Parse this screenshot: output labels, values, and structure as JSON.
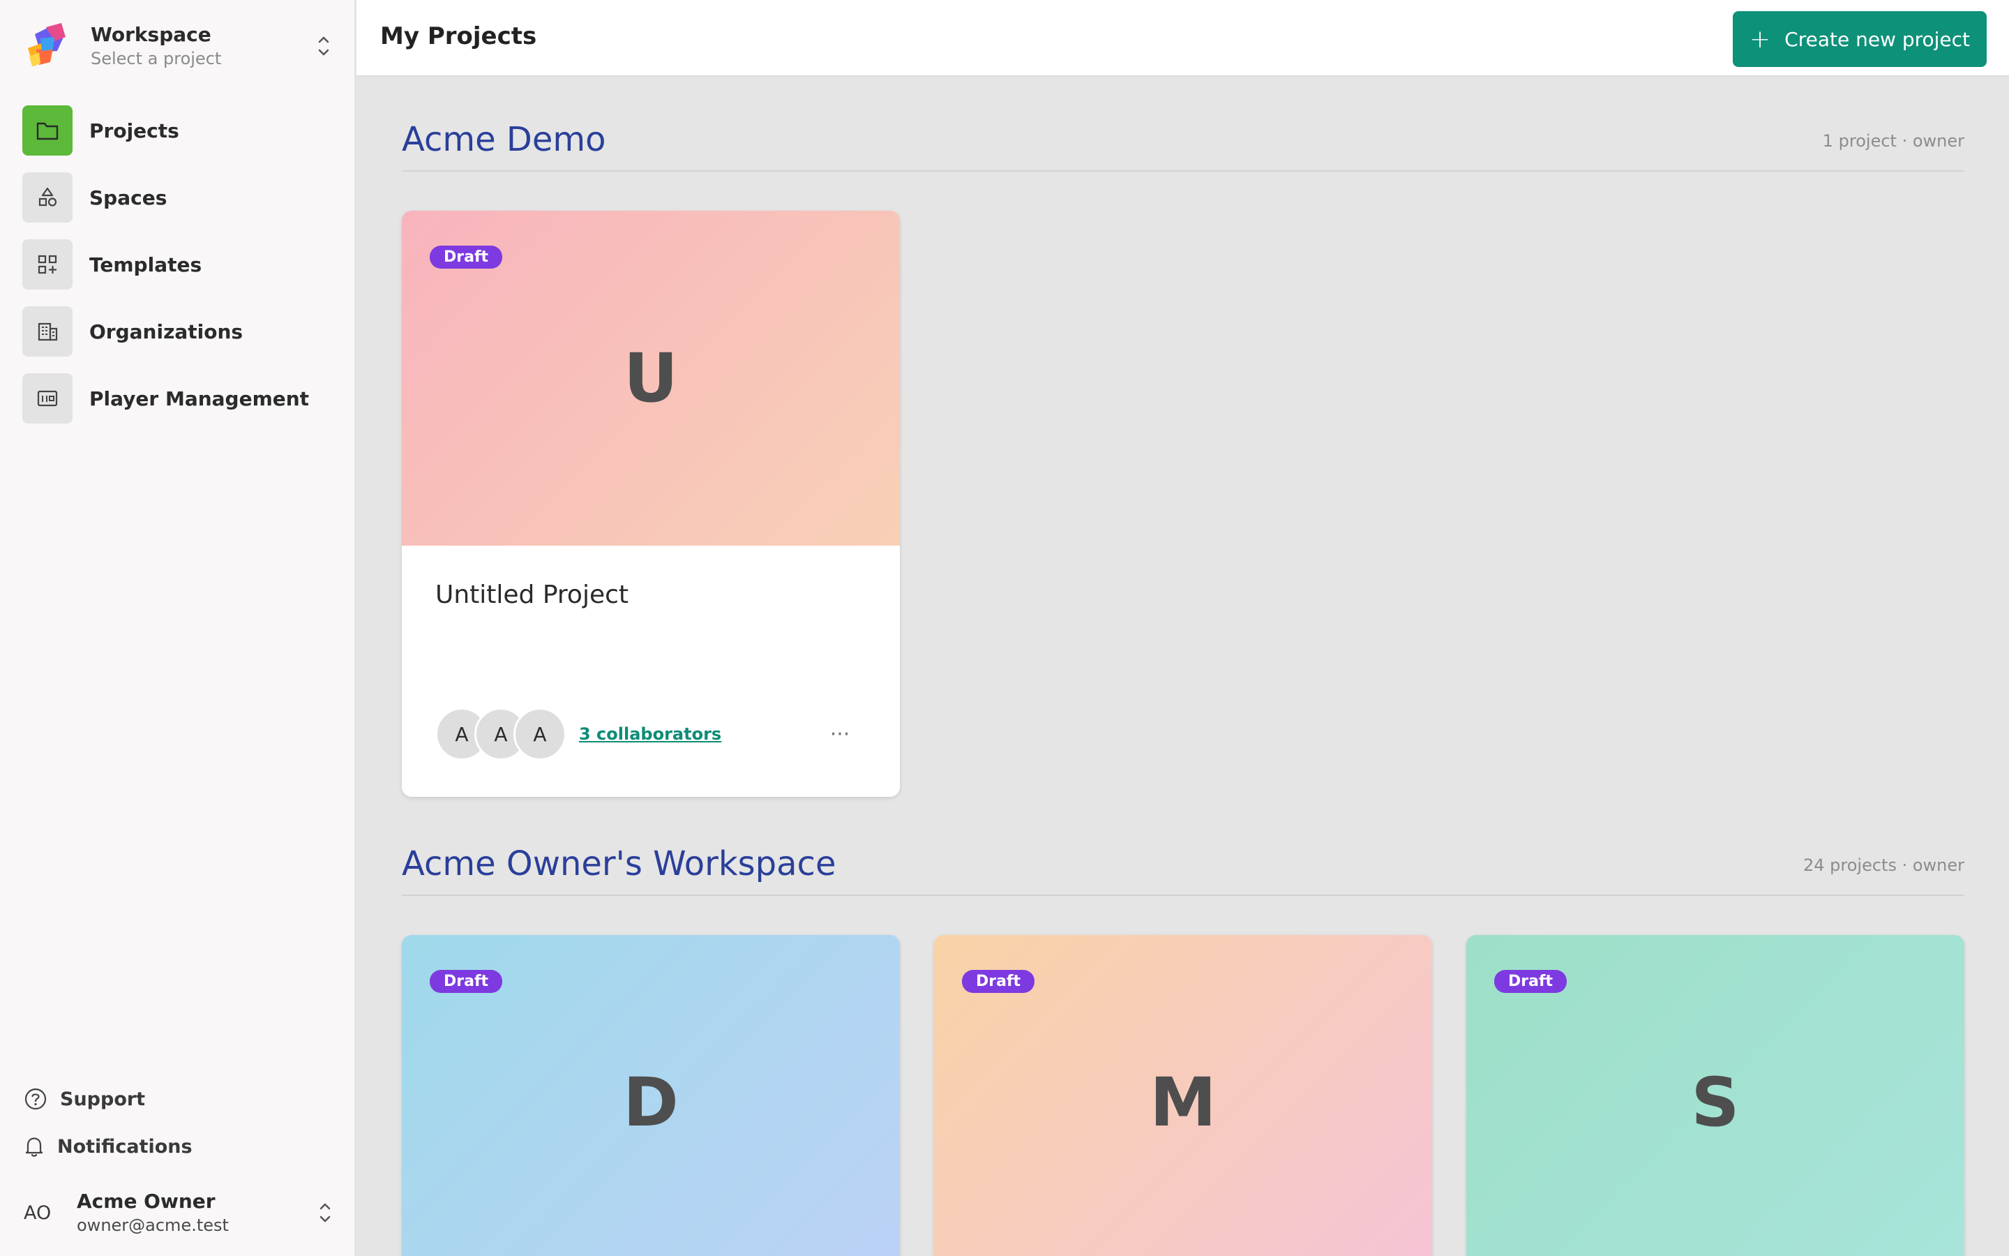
{
  "sidebar": {
    "workspace_title": "Workspace",
    "workspace_sub": "Select a project",
    "items": [
      {
        "label": "Projects",
        "icon": "folder-icon",
        "active": true
      },
      {
        "label": "Spaces",
        "icon": "shapes-icon",
        "active": false
      },
      {
        "label": "Templates",
        "icon": "grid-plus-icon",
        "active": false
      },
      {
        "label": "Organizations",
        "icon": "building-icon",
        "active": false
      },
      {
        "label": "Player Management",
        "icon": "player-card-icon",
        "active": false
      }
    ],
    "support_label": "Support",
    "notifications_label": "Notifications",
    "user": {
      "initials": "AO",
      "name": "Acme Owner",
      "email": "owner@acme.test"
    }
  },
  "header": {
    "title": "My Projects",
    "create_label": "Create new project"
  },
  "sections": [
    {
      "title": "Acme Demo",
      "meta": "1 project · owner",
      "cards": [
        {
          "badge": "Draft",
          "letter": "U",
          "title": "Untitled Project",
          "avatars": [
            "A",
            "A",
            "A"
          ],
          "collaborators": "3 collaborators",
          "more": "···",
          "gradient": [
            "#f8b4bd",
            "#f8d0b6"
          ]
        }
      ]
    },
    {
      "title": "Acme Owner's Workspace",
      "meta": "24 projects · owner",
      "cards": [
        {
          "badge": "Draft",
          "letter": "D",
          "gradient": [
            "#9fd9ea",
            "#bcd2f6"
          ]
        },
        {
          "badge": "Draft",
          "letter": "M",
          "gradient": [
            "#f8d3a6",
            "#f6c4d6"
          ]
        },
        {
          "badge": "Draft",
          "letter": "S",
          "gradient": [
            "#9ddfc8",
            "#a8e4da"
          ]
        }
      ]
    }
  ],
  "colors": {
    "accent": "#0e9179",
    "active_nav": "#5cb93a",
    "badge": "#7d3ae0",
    "section_title": "#2a3f9a"
  }
}
